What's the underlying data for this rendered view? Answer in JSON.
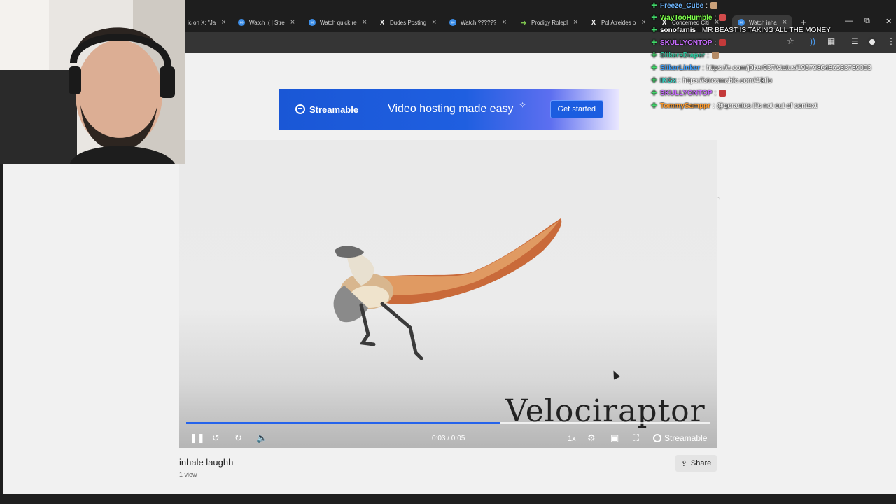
{
  "browser": {
    "tabs": [
      {
        "title": "ic on X: \"Ja",
        "icon": "x-logo-icon"
      },
      {
        "title": "Watch :( | Stre",
        "icon": "streamable-icon"
      },
      {
        "title": "Watch quick re",
        "icon": "streamable-icon"
      },
      {
        "title": "Dudes Posting",
        "icon": "x-logo-icon"
      },
      {
        "title": "Watch ?????? ",
        "icon": "streamable-icon"
      },
      {
        "title": "Prodigy Rolepl",
        "icon": "bolt-icon"
      },
      {
        "title": "Pol Atreides o",
        "icon": "x-logo-icon"
      },
      {
        "title": "Concerned Citi",
        "icon": "x-logo-icon"
      },
      {
        "title": "Watch inha",
        "icon": "streamable-icon"
      }
    ]
  },
  "ad": {
    "brand": "Streamable",
    "tagline": "Video hosting made easy",
    "cta": "Get started"
  },
  "video": {
    "overlay_title": "Velociraptor",
    "time": "0:03 / 0:05",
    "progress_fraction": 0.6,
    "speed": "1x",
    "brand": "Streamable",
    "name": "inhale laughh",
    "views": "1 view",
    "share_label": "Share"
  },
  "chat": [
    {
      "user": "Freeze_Cube",
      "color": "#6fb7ff",
      "text": "",
      "emote": "#c9a07a"
    },
    {
      "user": "WayTooHumble",
      "color": "#7dff4a",
      "text": "",
      "emote": "#d14b4b"
    },
    {
      "user": "sonofarnis",
      "color": "#ffffff",
      "text": "MR BEAST IS TAKING ALL THE MONEY",
      "emote": ""
    },
    {
      "user": "SKULLYONTOP",
      "color": "#c86bff",
      "text": "",
      "emote": "#c43a3a"
    },
    {
      "user": "SlikersDiaper",
      "color": "#2ec9a0",
      "text": "",
      "emote": "#b58b66"
    },
    {
      "user": "SlikerLinker",
      "color": "#3aa0ff",
      "text": "https://x.com/j0ker937/status/1957986486533739003",
      "emote": ""
    },
    {
      "user": "IKGx",
      "color": "#39d6c6",
      "text": "https://streamable.com/4tktlo",
      "emote": ""
    },
    {
      "user": "SKULLYONTOP",
      "color": "#c86bff",
      "text": "",
      "emote": "#c43a3a"
    },
    {
      "user": "TommySamppr",
      "color": "#ff9c2e",
      "text": "@qorantos it's not out of context",
      "emote": ""
    }
  ]
}
